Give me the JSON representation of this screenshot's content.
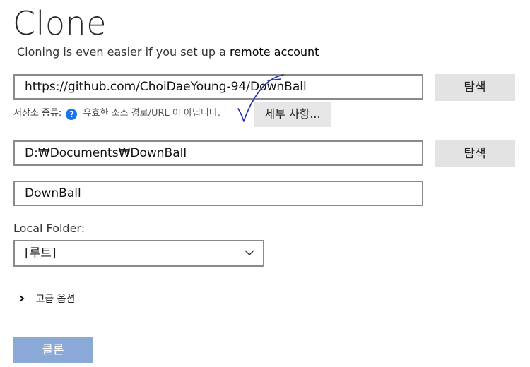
{
  "page": {
    "title": "Clone"
  },
  "subtitle": {
    "text": "Cloning is even easier if you set up a",
    "link": "remote account"
  },
  "url_input": {
    "value": "https://github.com/ChoiDaeYoung-94/DownBall"
  },
  "browse_button_1": {
    "label": "탐색"
  },
  "repo_status": {
    "label": "저장소 종류:",
    "message": "유효한 소스 경로/URL 이 아닙니다.",
    "details_button": "세부 사항..."
  },
  "path_input": {
    "value": "D:₩Documents₩DownBall"
  },
  "browse_button_2": {
    "label": "탐색"
  },
  "name_input": {
    "value": "DownBall"
  },
  "local_folder": {
    "label": "Local Folder:",
    "selected": "[루트]"
  },
  "advanced": {
    "label": "고급 옵션"
  },
  "clone_button": {
    "label": "클론"
  },
  "colors": {
    "accent": "#8aa9d6",
    "help": "#1a73e8",
    "annotation": "#1f2fa8"
  }
}
